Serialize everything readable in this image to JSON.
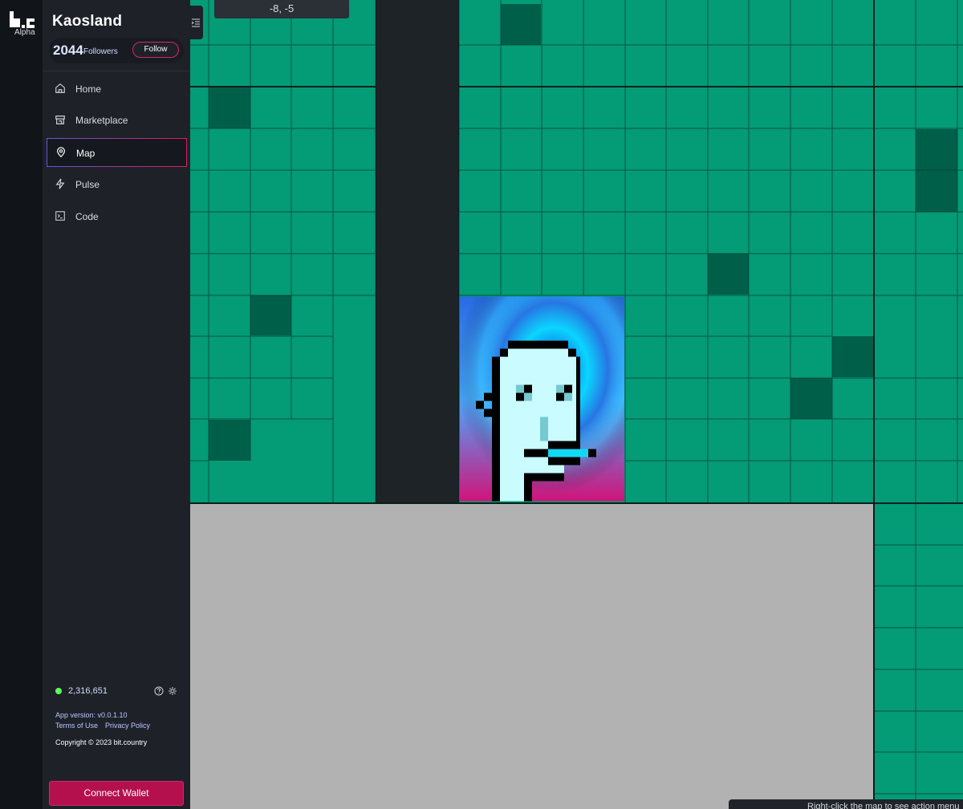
{
  "brand": {
    "logo_text": "b.c",
    "sub": "Alpha"
  },
  "sidebar": {
    "title": "Kaosland",
    "followers": {
      "count": "2044",
      "label": "Followers",
      "button": "Follow"
    },
    "nav": [
      {
        "label": "Home",
        "icon": "home-icon"
      },
      {
        "label": "Marketplace",
        "icon": "store-icon"
      },
      {
        "label": "Map",
        "icon": "map-pin-icon",
        "active": true
      },
      {
        "label": "Pulse",
        "icon": "bolt-icon"
      },
      {
        "label": "Code",
        "icon": "terminal-icon"
      }
    ],
    "online": "2,316,651",
    "version": "App version: v0.0.1.10",
    "terms": "Terms of Use",
    "privacy": "Privacy Policy",
    "copyright": "Copyright © 2023 bit.country",
    "connect": "Connect Wallet"
  },
  "map": {
    "coords": "-8, -5",
    "hint": "Right-click the map to see action menu",
    "colors": {
      "land": "#049b77",
      "owned": "#005f49",
      "road": "#1e2328",
      "empty": "#b2b2b2"
    }
  }
}
